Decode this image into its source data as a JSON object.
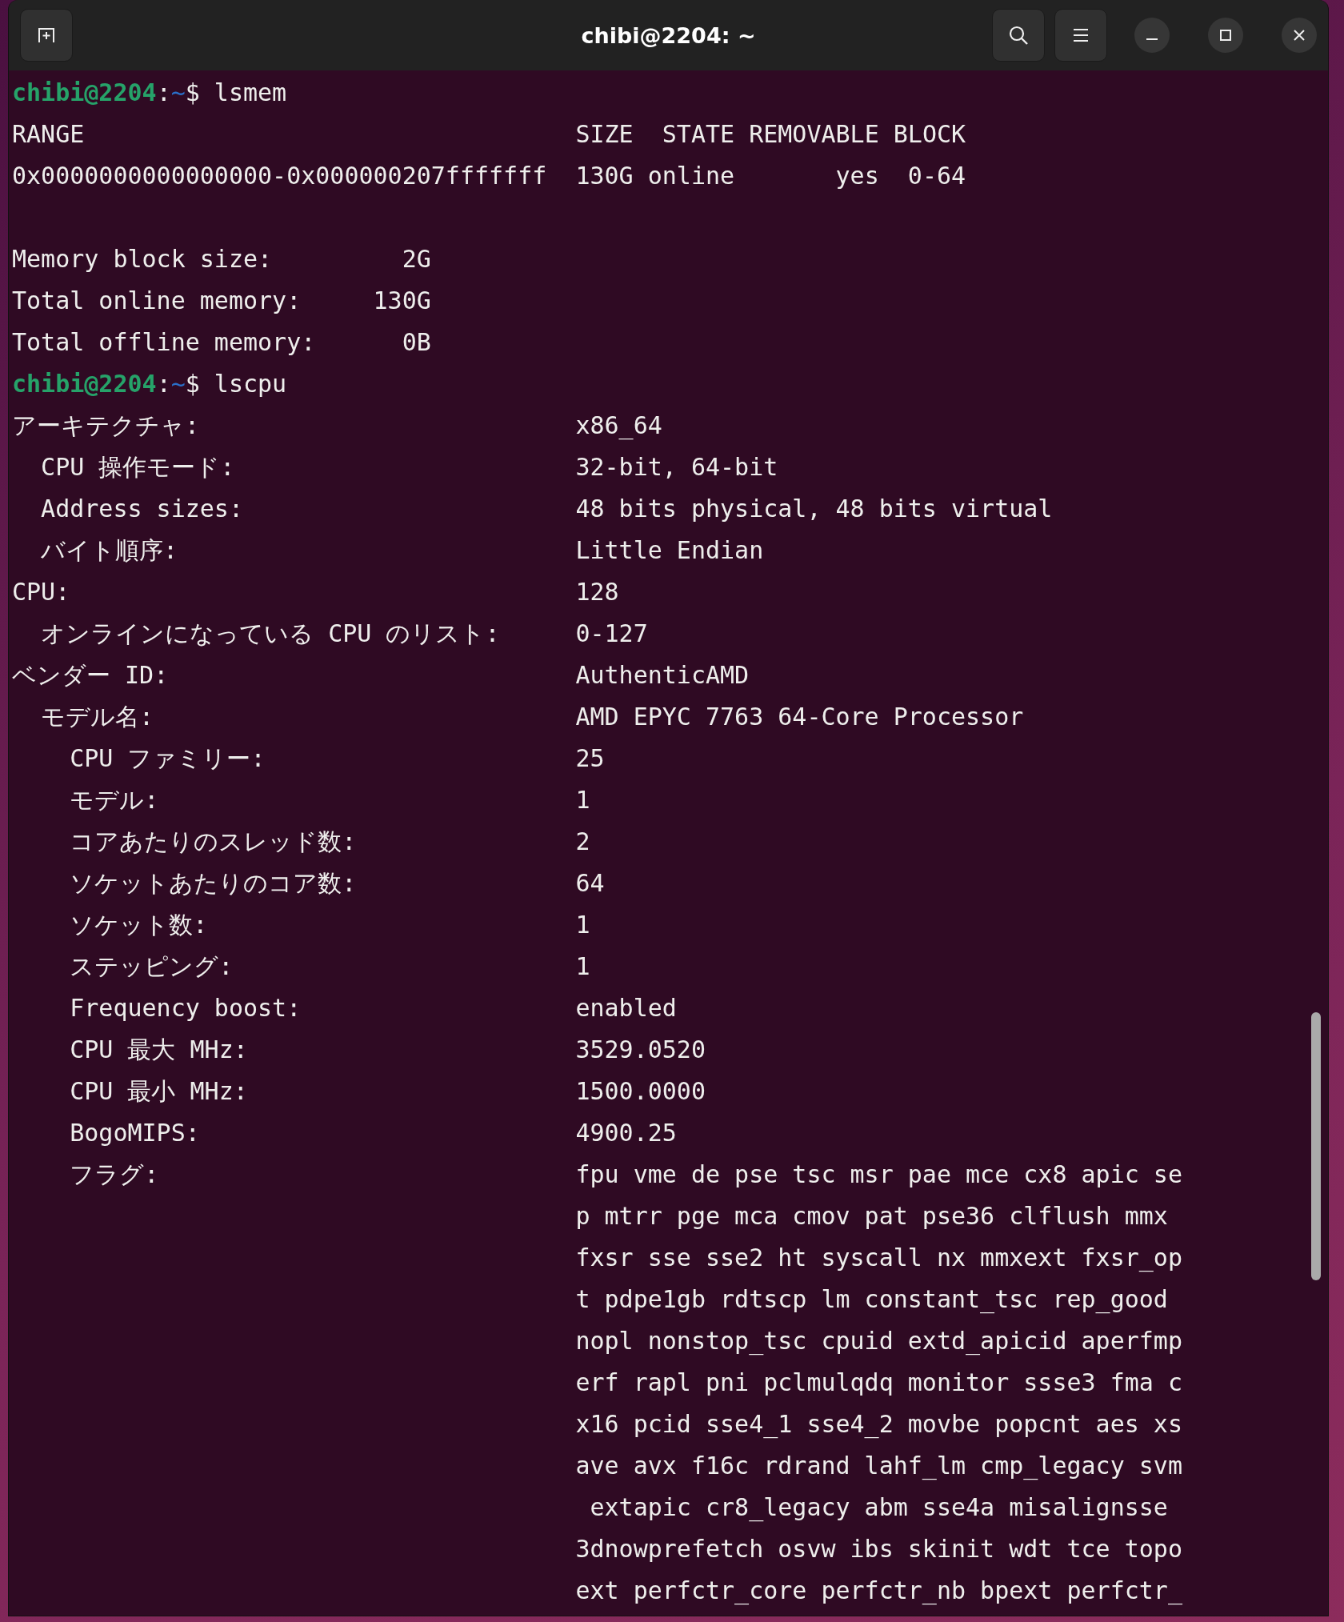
{
  "window": {
    "title": "chibi@2204: ~"
  },
  "lines": [
    {
      "kind": "prompt",
      "user": "chibi@2204",
      "sep": ":",
      "path": "~",
      "symbol": "$",
      "command": "lsmem"
    },
    {
      "kind": "text",
      "text": "RANGE                                  SIZE  STATE REMOVABLE BLOCK"
    },
    {
      "kind": "text",
      "text": "0x0000000000000000-0x000000207fffffff  130G online       yes  0-64"
    },
    {
      "kind": "blank"
    },
    {
      "kind": "text",
      "text": "Memory block size:         2G"
    },
    {
      "kind": "text",
      "text": "Total online memory:     130G"
    },
    {
      "kind": "text",
      "text": "Total offline memory:      0B"
    },
    {
      "kind": "prompt",
      "user": "chibi@2204",
      "sep": ":",
      "path": "~",
      "symbol": "$",
      "command": "lscpu"
    },
    {
      "kind": "fields",
      "fields": [
        {
          "label": "アーキテクチャ:",
          "value": "x86_64",
          "children": [
            {
              "label": "CPU 操作モード:",
              "value": "32-bit, 64-bit"
            },
            {
              "label": "Address sizes:",
              "value": "48 bits physical, 48 bits virtual"
            },
            {
              "label": "バイト順序:",
              "value": "Little Endian"
            }
          ]
        },
        {
          "label": "CPU:",
          "value": "128",
          "children": [
            {
              "label": "オンラインになっている CPU のリスト:",
              "value": "0-127"
            }
          ]
        },
        {
          "label": "ベンダー ID:",
          "value": "AuthenticAMD",
          "children": [
            {
              "label": "モデル名:",
              "value": "AMD EPYC 7763 64-Core Processor",
              "children": [
                {
                  "label": "CPU ファミリー:",
                  "value": "25"
                },
                {
                  "label": "モデル:",
                  "value": "1"
                },
                {
                  "label": "コアあたりのスレッド数:",
                  "value": "2"
                },
                {
                  "label": "ソケットあたりのコア数:",
                  "value": "64"
                },
                {
                  "label": "ソケット数:",
                  "value": "1"
                },
                {
                  "label": "ステッピング:",
                  "value": "1"
                },
                {
                  "label": "Frequency boost:",
                  "value": "enabled"
                },
                {
                  "label": "CPU 最大 MHz:",
                  "value": "3529.0520"
                },
                {
                  "label": "CPU 最小 MHz:",
                  "value": "1500.0000"
                },
                {
                  "label": "BogoMIPS:",
                  "value": "4900.25"
                },
                {
                  "label": "フラグ:",
                  "value_lines": [
                    "fpu vme de pse tsc msr pae mce cx8 apic se",
                    "p mtrr pge mca cmov pat pse36 clflush mmx",
                    "fxsr sse sse2 ht syscall nx mmxext fxsr_op",
                    "t pdpe1gb rdtscp lm constant_tsc rep_good",
                    "nopl nonstop_tsc cpuid extd_apicid aperfmp",
                    "erf rapl pni pclmulqdq monitor ssse3 fma c",
                    "x16 pcid sse4_1 sse4_2 movbe popcnt aes xs",
                    "ave avx f16c rdrand lahf_lm cmp_legacy svm",
                    " extapic cr8_legacy abm sse4a misalignsse",
                    "3dnowprefetch osvw ibs skinit wdt tce topo",
                    "ext perfctr_core perfctr_nb bpext perfctr_"
                  ]
                }
              ]
            }
          ]
        }
      ]
    }
  ]
}
